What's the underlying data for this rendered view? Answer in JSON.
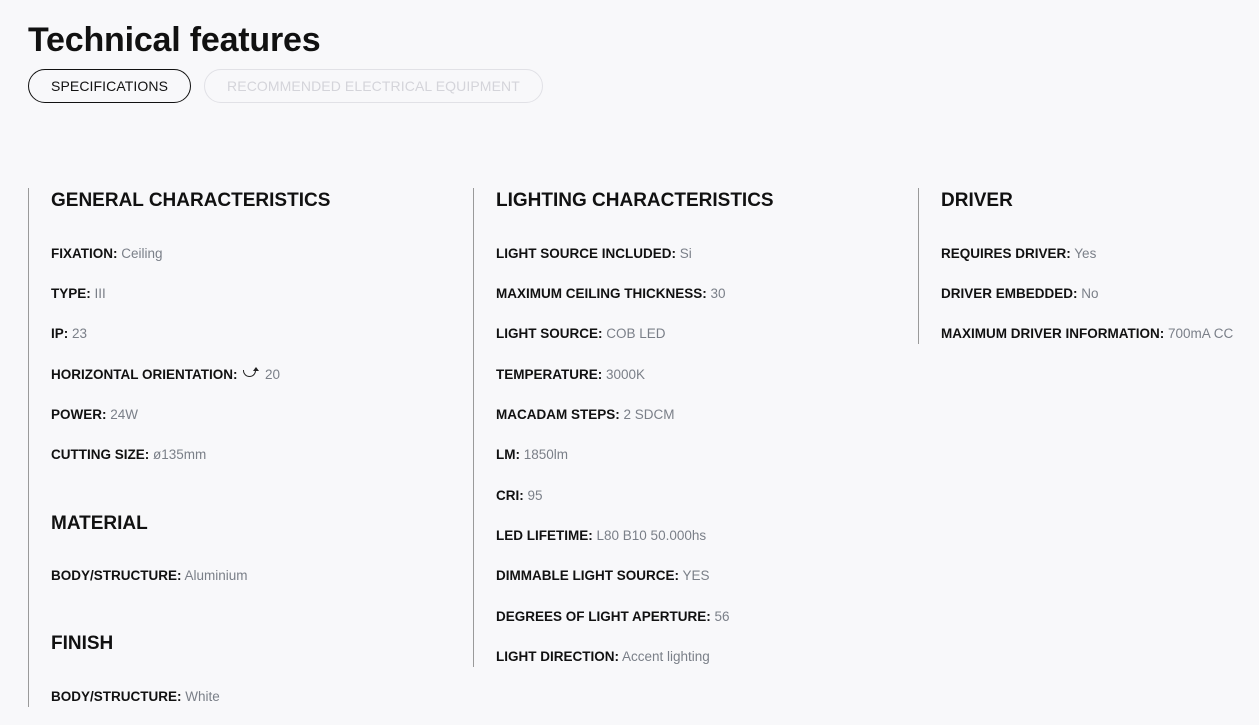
{
  "page": {
    "title": "Technical features"
  },
  "tabs": [
    {
      "label": "SPECIFICATIONS",
      "active": true
    },
    {
      "label": "RECOMMENDED ELECTRICAL EQUIPMENT",
      "active": false
    }
  ],
  "general": {
    "title": "GENERAL CHARACTERISTICS",
    "fixation": {
      "key": "FIXATION:",
      "value": "Ceiling"
    },
    "type": {
      "key": "TYPE:",
      "value": "III"
    },
    "ip": {
      "key": "IP:",
      "value": "23"
    },
    "horizontal_orientation": {
      "key": "HORIZONTAL ORIENTATION:",
      "icon": "rotate-icon",
      "value": "20"
    },
    "power": {
      "key": "POWER:",
      "value": "24W"
    },
    "cutting_size": {
      "key": "CUTTING SIZE:",
      "value": "ø135mm"
    }
  },
  "material": {
    "title": "MATERIAL",
    "body_structure": {
      "key": "BODY/STRUCTURE:",
      "value": "Aluminium"
    }
  },
  "finish": {
    "title": "FINISH",
    "body_structure": {
      "key": "BODY/STRUCTURE:",
      "value": "White"
    }
  },
  "lighting": {
    "title": "LIGHTING CHARACTERISTICS",
    "light_source_included": {
      "key": "LIGHT SOURCE INCLUDED:",
      "value": "Si"
    },
    "max_ceiling_thickness": {
      "key": "MAXIMUM CEILING THICKNESS:",
      "value": "30"
    },
    "light_source": {
      "key": "LIGHT SOURCE:",
      "value": "COB LED"
    },
    "temperature": {
      "key": "TEMPERATURE:",
      "value": "3000K"
    },
    "macadam_steps": {
      "key": "MACADAM STEPS:",
      "value": "2 SDCM"
    },
    "lm": {
      "key": "LM:",
      "value": "1850lm"
    },
    "cri": {
      "key": "CRI:",
      "value": "95"
    },
    "led_lifetime": {
      "key": "LED LIFETIME:",
      "value": "L80 B10 50.000hs"
    },
    "dimmable": {
      "key": "DIMMABLE LIGHT SOURCE:",
      "value": "YES"
    },
    "aperture": {
      "key": "DEGREES OF LIGHT APERTURE:",
      "value": "56"
    },
    "direction": {
      "key": "LIGHT DIRECTION:",
      "value": "Accent lighting"
    }
  },
  "driver": {
    "title": "DRIVER",
    "requires_driver": {
      "key": "REQUIRES DRIVER:",
      "value": "Yes"
    },
    "driver_embedded": {
      "key": "DRIVER EMBEDDED:",
      "value": "No"
    },
    "max_driver_info": {
      "key": "MAXIMUM DRIVER INFORMATION:",
      "value": "700mA CC"
    }
  }
}
